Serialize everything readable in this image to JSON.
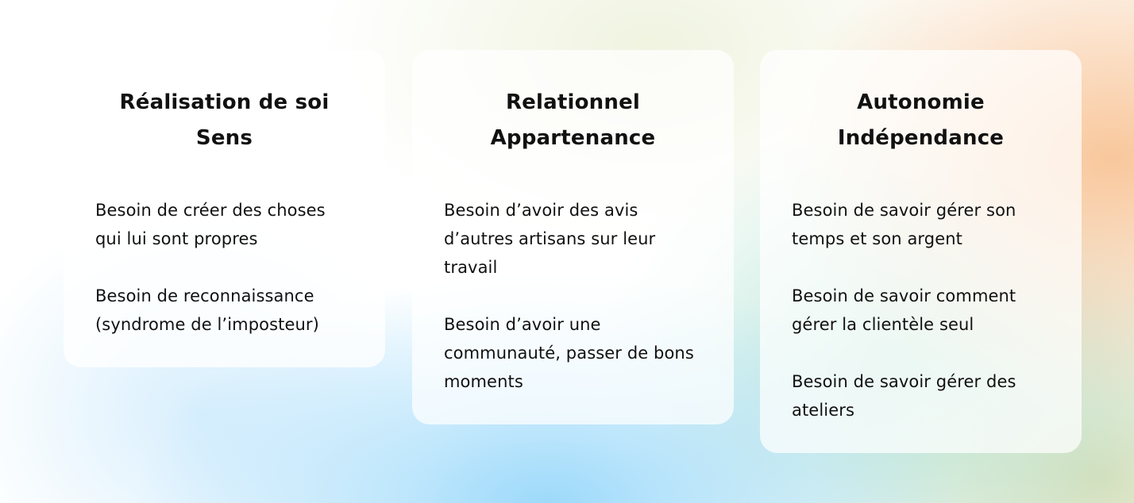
{
  "cards": [
    {
      "title_line1": "Réalisation de soi",
      "title_line2": "Sens",
      "needs": [
        "Besoin de créer des choses qui lui sont propres",
        "Besoin de reconnaissance (syndrome de l’imposteur)"
      ]
    },
    {
      "title_line1": "Relationnel",
      "title_line2": "Appartenance",
      "needs": [
        "Besoin d’avoir des avis d’autres artisans sur leur travail",
        "Besoin d’avoir une communauté, passer de bons moments"
      ]
    },
    {
      "title_line1": "Autonomie",
      "title_line2": "Indépendance",
      "needs": [
        "Besoin de savoir gérer son temps et son argent",
        "Besoin de savoir comment gérer la clientèle seul",
        "Besoin de savoir gérer des ateliers"
      ]
    }
  ],
  "colors": {
    "card_background": "#ffffff",
    "text": "#111111",
    "gradient_blue": "#96d7fa",
    "gradient_orange": "#f8c496",
    "gradient_mint": "#b0e2d2"
  }
}
